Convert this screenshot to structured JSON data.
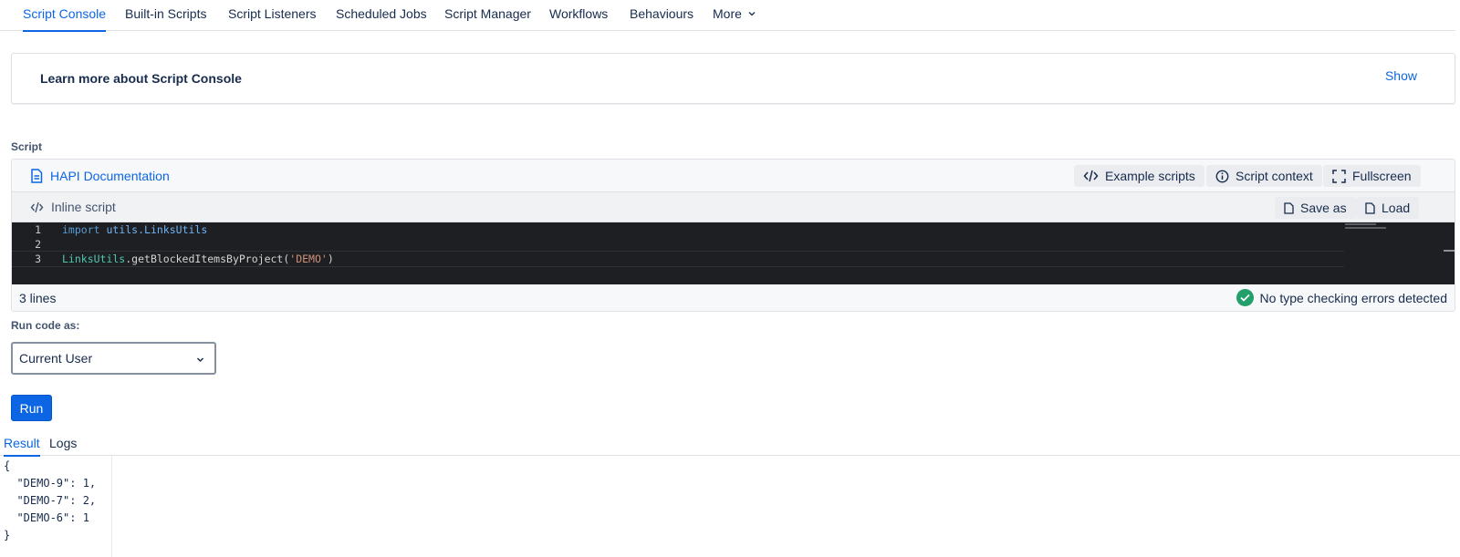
{
  "nav": {
    "tabs": [
      {
        "label": "Script Console"
      },
      {
        "label": "Built-in Scripts"
      },
      {
        "label": "Script Listeners"
      },
      {
        "label": "Scheduled Jobs"
      },
      {
        "label": "Script Manager"
      },
      {
        "label": "Workflows"
      },
      {
        "label": "Behaviours"
      },
      {
        "label": "More"
      }
    ],
    "active_tab": "Script Console"
  },
  "learn_more": {
    "title": "Learn more about Script Console",
    "show_label": "Show"
  },
  "script": {
    "section_label": "Script",
    "hapi_link": "HAPI Documentation",
    "example_scripts": "Example scripts",
    "script_context": "Script context",
    "fullscreen": "Fullscreen",
    "inline_label": "Inline script",
    "save_as": "Save as",
    "load": "Load",
    "code": {
      "line_numbers": [
        "1",
        "2",
        "3"
      ],
      "line1": {
        "kw": "import",
        "pkg": "utils.LinksUtils"
      },
      "line3": {
        "cls": "LinksUtils",
        "method": ".getBlockedItemsByProject(",
        "str": "'DEMO'",
        "close": ")"
      }
    },
    "lines_count": "3 lines",
    "typecheck_status": "No type checking errors detected"
  },
  "run_as": {
    "label": "Run code as:",
    "selected": "Current User"
  },
  "run_button": "Run",
  "result_tabs": {
    "result": "Result",
    "logs": "Logs",
    "active": "Result"
  },
  "result_output": {
    "open": "{",
    "lines": [
      "  \"DEMO-9\": 1,",
      "  \"DEMO-7\": 2,",
      "  \"DEMO-6\": 1"
    ],
    "close": "}"
  },
  "colors": {
    "accent": "#0c66e4",
    "success": "#22a06b",
    "editor_bg": "#1e1f22"
  }
}
